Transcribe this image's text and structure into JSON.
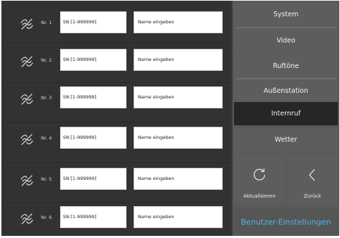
{
  "rows": [
    {
      "nr": "Nr. 1",
      "sn": "SN [1-999999]",
      "name": "Name eingeben"
    },
    {
      "nr": "Nr. 2",
      "sn": "SN [1-999999]",
      "name": "Name eingeben"
    },
    {
      "nr": "Nr. 3",
      "sn": "SN [1-999999]",
      "name": "Name eingeben"
    },
    {
      "nr": "Nr. 4",
      "sn": "SN [1-999999]",
      "name": "Name eingeben"
    },
    {
      "nr": "Nr. 5",
      "sn": "SN [1-999999]",
      "name": "Name eingeben"
    },
    {
      "nr": "Nr. 6",
      "sn": "SN [1-999999]",
      "name": "Name eingeben"
    }
  ],
  "menu": {
    "system": "System",
    "video": "Video",
    "ruftone": "Ruftöne",
    "aussenstation": "Außenstation",
    "internruf": "Internruf",
    "wetter": "Wetter"
  },
  "actions": {
    "refresh": "Aktualisieren",
    "back": "Zurück"
  },
  "user_settings": "Benutzer-Einstellungen",
  "icons": {
    "row_icon": "disconnected-link-icon",
    "refresh_icon": "refresh-icon",
    "back_icon": "chevron-left-icon"
  },
  "colors": {
    "accent": "#4fb3e8",
    "active_menu": "#262626"
  }
}
